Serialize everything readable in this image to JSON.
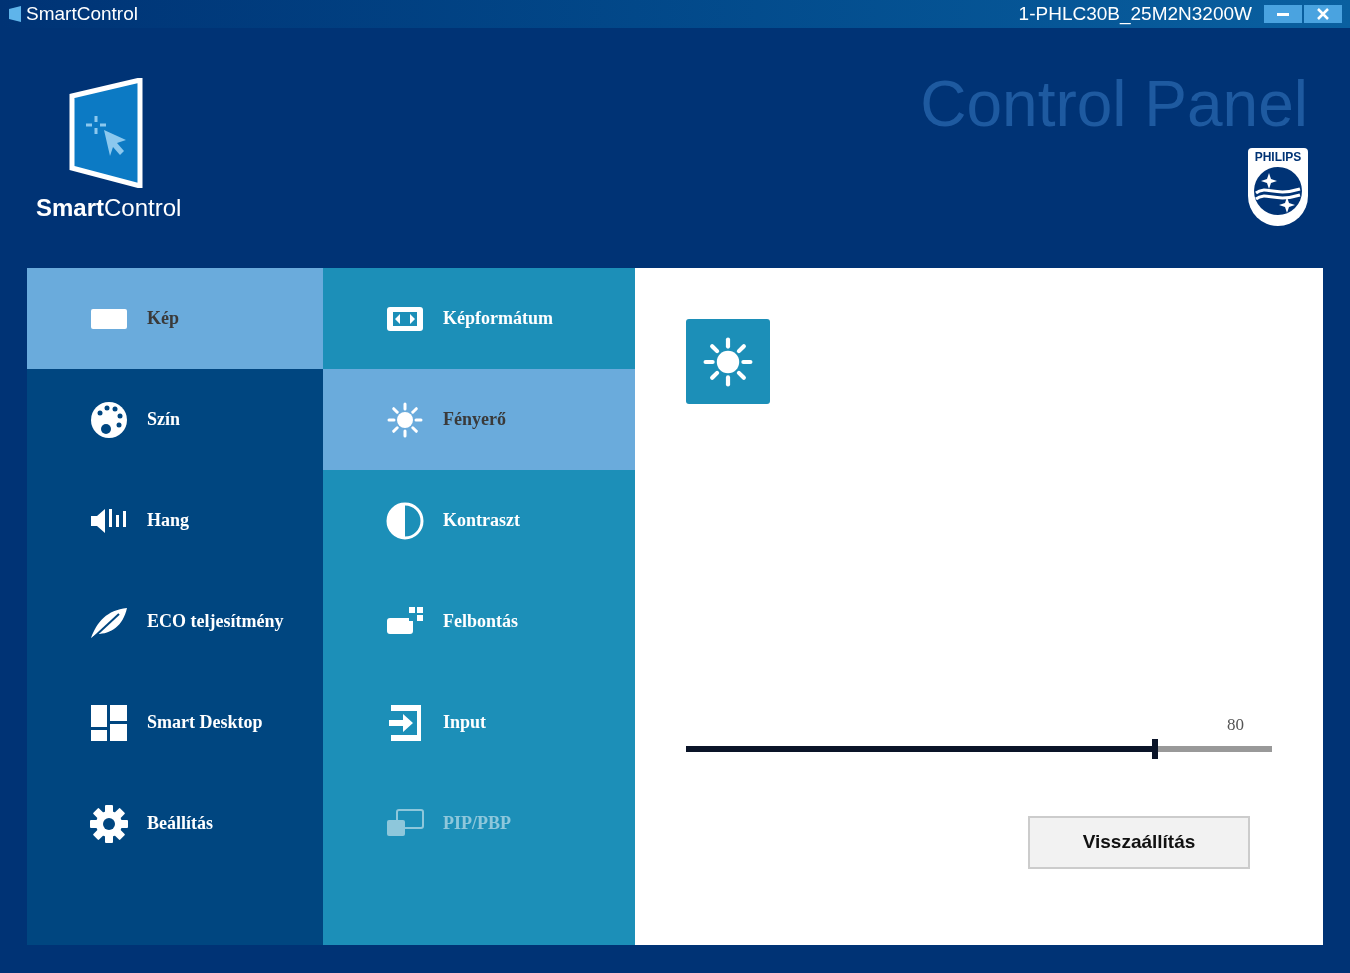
{
  "window": {
    "title": "SmartControl",
    "device": "1-PHLC30B_25M2N3200W"
  },
  "header": {
    "logo_text": "**Smart**Control",
    "title": "Control Panel",
    "brand": "PHILIPS"
  },
  "categories": [
    {
      "kind": "picture",
      "label": "Kép",
      "selected": true
    },
    {
      "kind": "palette",
      "label": "Szín",
      "selected": false
    },
    {
      "kind": "sound",
      "label": "Hang",
      "selected": false
    },
    {
      "kind": "leaf",
      "label": "ECO teljesítmény",
      "selected": false
    },
    {
      "kind": "desktop",
      "label": "Smart Desktop",
      "selected": false
    },
    {
      "kind": "gear",
      "label": "Beállítás",
      "selected": false
    }
  ],
  "submenu": [
    {
      "kind": "aspect",
      "label": "Képformátum",
      "selected": false,
      "disabled": false
    },
    {
      "kind": "sun",
      "label": "Fényerő",
      "selected": true,
      "disabled": false
    },
    {
      "kind": "contrast",
      "label": "Kontraszt",
      "selected": false,
      "disabled": false
    },
    {
      "kind": "resolution",
      "label": "Felbontás",
      "selected": false,
      "disabled": false
    },
    {
      "kind": "input",
      "label": "Input",
      "selected": false,
      "disabled": false
    },
    {
      "kind": "pip",
      "label": "PIP/PBP",
      "selected": false,
      "disabled": true
    }
  ],
  "content": {
    "slider": {
      "reading": "80",
      "level": 0.8
    },
    "reset_button": "Visszaállítás"
  }
}
